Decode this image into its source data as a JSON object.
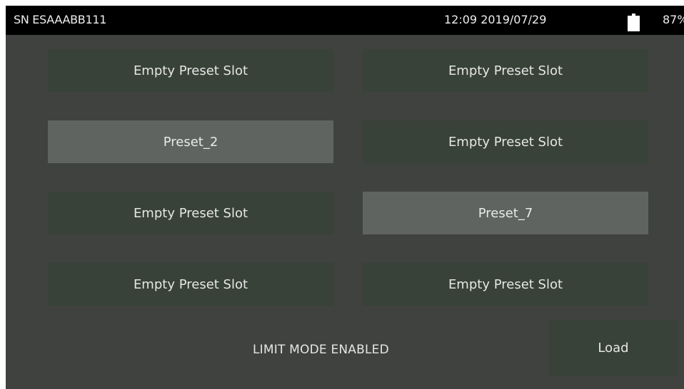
{
  "status_bar": {
    "serial": "SN ESAAABB111",
    "datetime": "12:09 2019/07/29",
    "battery_percent": "87%",
    "battery_icon": "battery-icon"
  },
  "presets": [
    {
      "label": "Empty Preset Slot",
      "filled": false
    },
    {
      "label": "Empty Preset Slot",
      "filled": false
    },
    {
      "label": "Preset_2",
      "filled": true
    },
    {
      "label": "Empty Preset Slot",
      "filled": false
    },
    {
      "label": "Empty Preset Slot",
      "filled": false
    },
    {
      "label": "Preset_7",
      "filled": true
    },
    {
      "label": "Empty Preset Slot",
      "filled": false
    },
    {
      "label": "Empty Preset Slot",
      "filled": false
    }
  ],
  "footer": {
    "mode_text": "LIMIT MODE ENABLED",
    "load_label": "Load"
  },
  "colors": {
    "screen_background": "#3f423f",
    "empty_slot": "#384238",
    "filled_slot": "#5f6461",
    "status_bar": "#000000"
  }
}
